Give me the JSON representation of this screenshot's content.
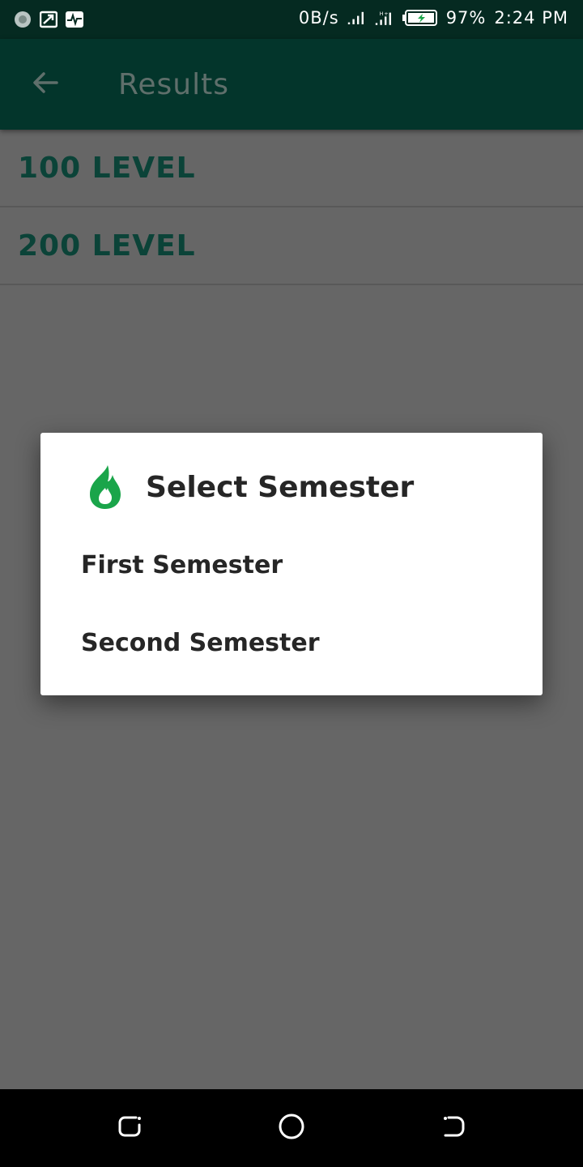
{
  "status_bar": {
    "network_speed": "0B/s",
    "battery": "97%",
    "time": "2:24 PM",
    "icons": [
      "app-notification-icon",
      "screen-cast-icon",
      "activity-icon",
      "signal-icon",
      "signal-hplus-icon",
      "battery-charging-icon"
    ]
  },
  "app_bar": {
    "title": "Results",
    "back_icon": "arrow-back-icon",
    "background": "#03352b"
  },
  "levels": [
    {
      "label": "100 LEVEL"
    },
    {
      "label": "200 LEVEL"
    }
  ],
  "dialog": {
    "title": "Select Semester",
    "icon": "flame-icon",
    "icon_color": "#1aa54a",
    "options": [
      {
        "label": "First Semester"
      },
      {
        "label": "Second Semester"
      }
    ]
  },
  "nav_bar": {
    "buttons": [
      "recents-icon",
      "home-icon",
      "back-icon"
    ]
  }
}
